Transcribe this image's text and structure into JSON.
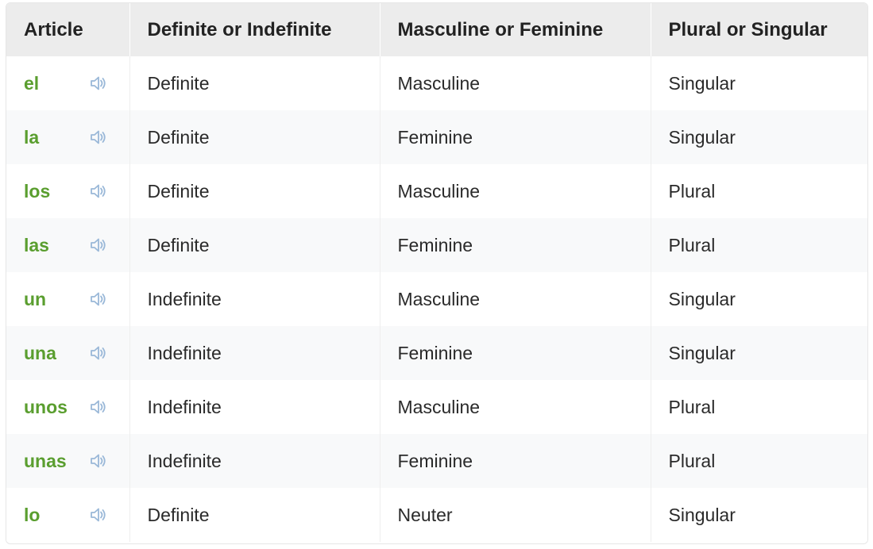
{
  "colors": {
    "article_green": "#5a9e2f",
    "speaker_blue": "#9ab8d8",
    "header_bg": "#ececec",
    "stripe_bg": "#f8f9fa"
  },
  "table": {
    "headers": [
      "Article",
      "Definite or Indefinite",
      "Masculine or Feminine",
      "Plural or Singular"
    ],
    "speaker_icon": "speaker-icon",
    "rows": [
      {
        "article": "el",
        "definite": "Definite",
        "gender": "Masculine",
        "number": "Singular"
      },
      {
        "article": "la",
        "definite": "Definite",
        "gender": "Feminine",
        "number": "Singular"
      },
      {
        "article": "los",
        "definite": "Definite",
        "gender": "Masculine",
        "number": "Plural"
      },
      {
        "article": "las",
        "definite": "Definite",
        "gender": "Feminine",
        "number": "Plural"
      },
      {
        "article": "un",
        "definite": "Indefinite",
        "gender": "Masculine",
        "number": "Singular"
      },
      {
        "article": "una",
        "definite": "Indefinite",
        "gender": "Feminine",
        "number": "Singular"
      },
      {
        "article": "unos",
        "definite": "Indefinite",
        "gender": "Masculine",
        "number": "Plural"
      },
      {
        "article": "unas",
        "definite": "Indefinite",
        "gender": "Feminine",
        "number": "Plural"
      },
      {
        "article": "lo",
        "definite": "Definite",
        "gender": "Neuter",
        "number": "Singular"
      }
    ]
  }
}
